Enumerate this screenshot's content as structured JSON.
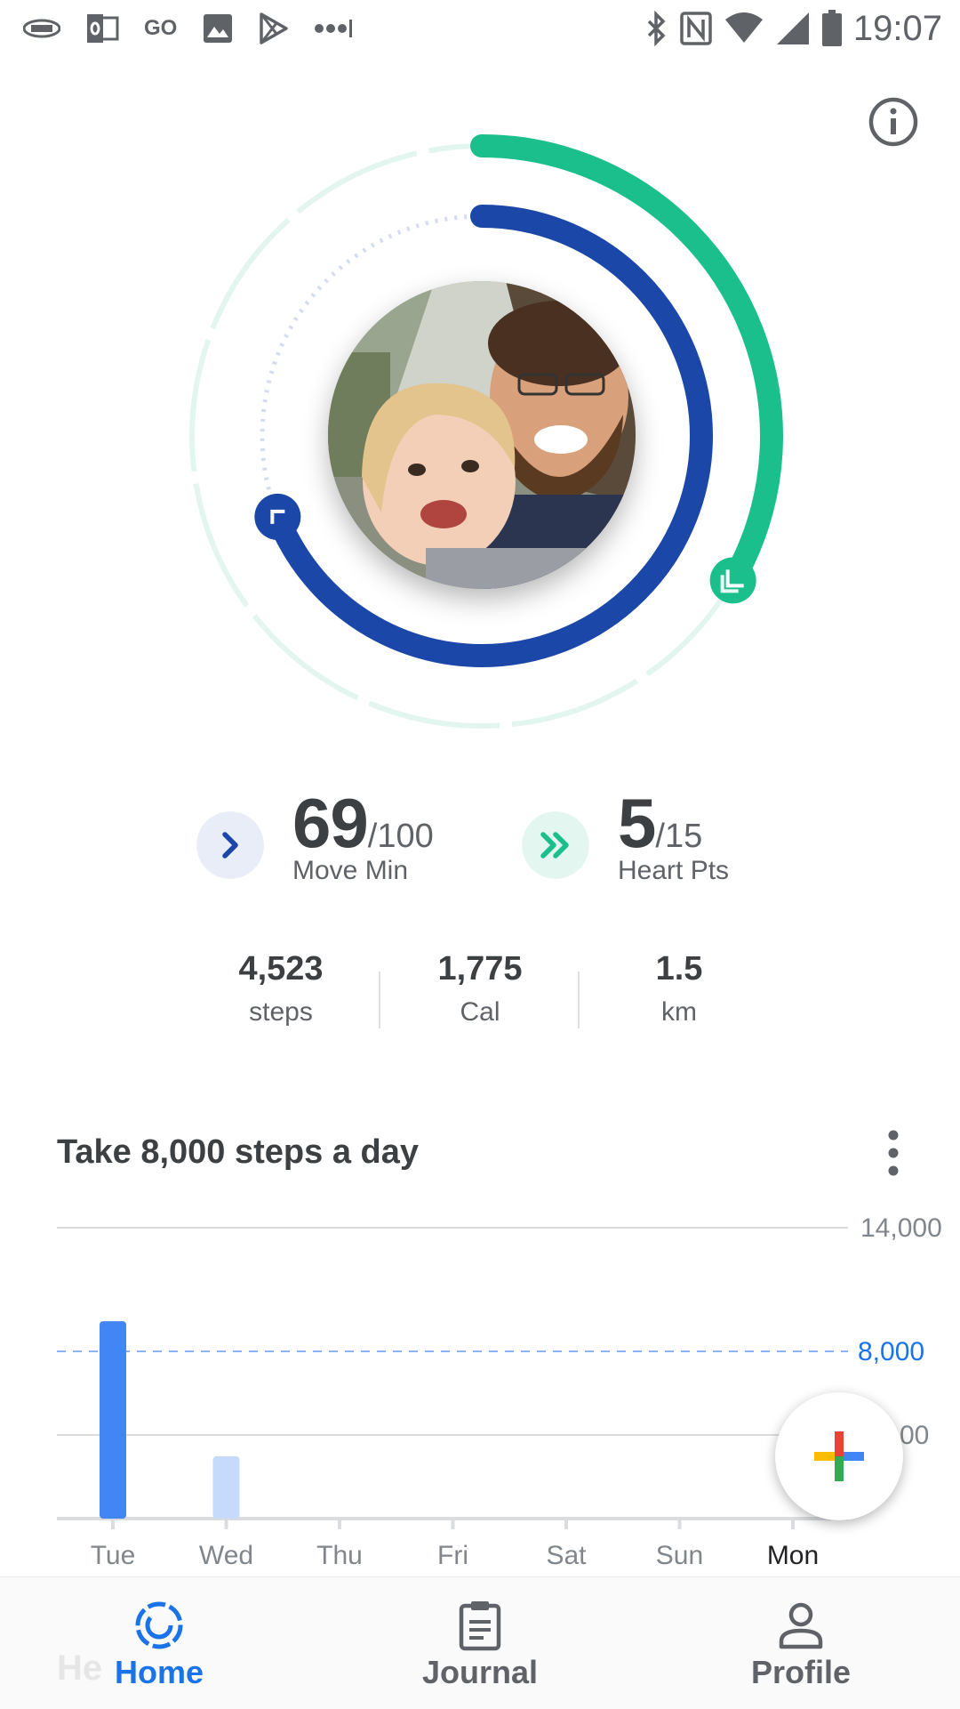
{
  "status_bar": {
    "left_icons": [
      "afl-icon",
      "outlook-icon",
      "go-text",
      "gallery-icon",
      "play-store-icon",
      "more-notifications-icon"
    ],
    "go_label": "GO",
    "time": "19:07"
  },
  "colors": {
    "heart_teal": "#1bbf8c",
    "move_blue": "#1a47a8",
    "accent_blue": "#1a73e8",
    "bar_blue": "#4285f4",
    "bar_light": "#c6dafc"
  },
  "rings": {
    "heart_points_progress": 0.333,
    "move_minutes_progress": 0.69
  },
  "metrics": {
    "move": {
      "value": "69",
      "goal": "/100",
      "label": "Move Min"
    },
    "heart": {
      "value": "5",
      "goal": "/15",
      "label": "Heart Pts"
    }
  },
  "stats": [
    {
      "value": "4,523",
      "unit": "steps"
    },
    {
      "value": "1,775",
      "unit": "Cal"
    },
    {
      "value": "1.5",
      "unit": "km"
    }
  ],
  "goal_card": {
    "title": "Take 8,000 steps a day"
  },
  "chart_data": {
    "type": "bar",
    "categories": [
      "Tue",
      "Wed",
      "Thu",
      "Fri",
      "Sat",
      "Sun",
      "Mon"
    ],
    "values": [
      9500,
      3000,
      0,
      0,
      0,
      0,
      0
    ],
    "goal_line": 8000,
    "goal_label": "8,000",
    "ymax_label": "14,000",
    "mid_label_partial": "00",
    "ylim": [
      0,
      14000
    ],
    "highlight_category": "Mon"
  },
  "bottom_nav": {
    "peek_text": "He",
    "items": [
      {
        "label": "Home",
        "icon": "home-ring-icon",
        "active": true
      },
      {
        "label": "Journal",
        "icon": "journal-clipboard-icon",
        "active": false
      },
      {
        "label": "Profile",
        "icon": "profile-person-icon",
        "active": false
      }
    ]
  }
}
